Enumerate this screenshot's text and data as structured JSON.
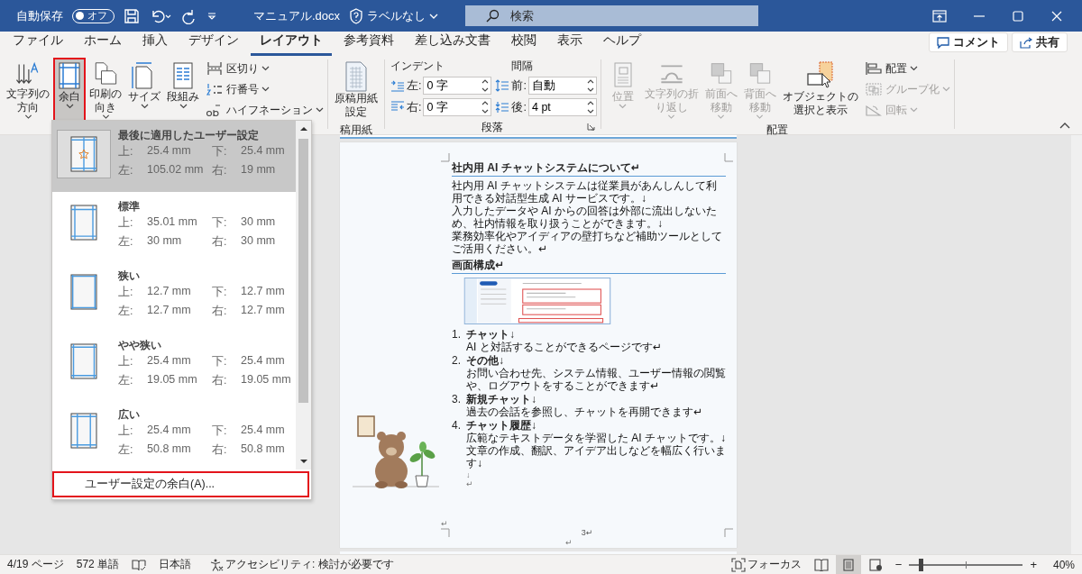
{
  "title_bar": {
    "autosave": {
      "label": "自動保存",
      "toggle_text": "オフ",
      "on": false
    },
    "document_name": "マニュアル.docx",
    "sensitivity": "ラベルなし",
    "search_placeholder": "検索"
  },
  "menu_tabs": [
    {
      "label": "ファイル",
      "selected": false
    },
    {
      "label": "ホーム",
      "selected": false
    },
    {
      "label": "挿入",
      "selected": false
    },
    {
      "label": "デザイン",
      "selected": false
    },
    {
      "label": "レイアウト",
      "selected": true
    },
    {
      "label": "参考資料",
      "selected": false
    },
    {
      "label": "差し込み文書",
      "selected": false
    },
    {
      "label": "校閲",
      "selected": false
    },
    {
      "label": "表示",
      "selected": false
    },
    {
      "label": "ヘルプ",
      "selected": false
    }
  ],
  "comment_button": "コメント",
  "share_button": "共有",
  "ribbon": {
    "page_setup": {
      "large_buttons": [
        {
          "kind": "text-direction",
          "lines": [
            "文字列の",
            "方向"
          ],
          "selected": false
        },
        {
          "kind": "margins",
          "lines": [
            "余白"
          ],
          "selected": true
        },
        {
          "kind": "orientation",
          "lines": [
            "印刷の",
            "向き"
          ],
          "selected": false
        },
        {
          "kind": "size",
          "lines": [
            "サイズ"
          ],
          "selected": false
        },
        {
          "kind": "columns",
          "lines": [
            "段組み"
          ],
          "selected": false
        }
      ],
      "small_buttons": [
        {
          "kind": "breaks",
          "label": "区切り",
          "disabled": false
        },
        {
          "kind": "line-numbers",
          "label": "行番号",
          "disabled": false
        },
        {
          "kind": "hyphenation",
          "label": "ハイフネーション",
          "disabled": false
        }
      ]
    },
    "manuscript": {
      "lines": [
        "原稿用紙",
        "設定"
      ],
      "group_label": "稿用紙"
    },
    "paragraph": {
      "indent_header": "インデント",
      "spacing_header": "間隔",
      "indent_fields": [
        {
          "kind": "left",
          "label": "左:",
          "value": "0 字"
        },
        {
          "kind": "right",
          "label": "右:",
          "value": "0 字"
        }
      ],
      "spacing_fields": [
        {
          "kind": "before",
          "label": "前:",
          "value": "自動"
        },
        {
          "kind": "after",
          "label": "後:",
          "value": "4 pt"
        }
      ],
      "group_label": "段落"
    },
    "arrange": {
      "large_buttons": [
        {
          "kind": "position",
          "lines": [
            "位置"
          ],
          "disabled": true
        },
        {
          "kind": "wrap",
          "lines": [
            "文字列の折",
            "り返し"
          ],
          "disabled": true
        },
        {
          "kind": "bring-forward",
          "lines": [
            "前面へ",
            "移動"
          ],
          "disabled": true
        },
        {
          "kind": "send-backward",
          "lines": [
            "背面へ",
            "移動"
          ],
          "disabled": true
        },
        {
          "kind": "selection-pane",
          "lines": [
            "オブジェクトの",
            "選択と表示"
          ],
          "disabled": false
        }
      ],
      "small_buttons": [
        {
          "kind": "align",
          "label": "配置",
          "disabled": false
        },
        {
          "kind": "group",
          "label": "グループ化",
          "disabled": true
        },
        {
          "kind": "rotate",
          "label": "回転",
          "disabled": true
        }
      ],
      "group_label": "配置"
    }
  },
  "margins_menu": {
    "items": [
      {
        "kind": "recent",
        "name": "最後に適用したユーザー設定",
        "selected": true,
        "fields": [
          {
            "label": "上:",
            "value": "25.4 mm"
          },
          {
            "label": "下:",
            "value": "25.4 mm"
          },
          {
            "label": "左:",
            "value": "105.02 mm"
          },
          {
            "label": "右:",
            "value": "19 mm"
          }
        ]
      },
      {
        "kind": "preset",
        "name": "標準",
        "selected": false,
        "fields": [
          {
            "label": "上:",
            "value": "35.01 mm"
          },
          {
            "label": "下:",
            "value": "30 mm"
          },
          {
            "label": "左:",
            "value": "30 mm"
          },
          {
            "label": "右:",
            "value": "30 mm"
          }
        ]
      },
      {
        "kind": "preset",
        "name": "狭い",
        "selected": false,
        "fields": [
          {
            "label": "上:",
            "value": "12.7 mm"
          },
          {
            "label": "下:",
            "value": "12.7 mm"
          },
          {
            "label": "左:",
            "value": "12.7 mm"
          },
          {
            "label": "右:",
            "value": "12.7 mm"
          }
        ]
      },
      {
        "kind": "preset",
        "name": "やや狭い",
        "selected": false,
        "fields": [
          {
            "label": "上:",
            "value": "25.4 mm"
          },
          {
            "label": "下:",
            "value": "25.4 mm"
          },
          {
            "label": "左:",
            "value": "19.05 mm"
          },
          {
            "label": "右:",
            "value": "19.05 mm"
          }
        ]
      },
      {
        "kind": "preset",
        "name": "広い",
        "selected": false,
        "fields": [
          {
            "label": "上:",
            "value": "25.4 mm"
          },
          {
            "label": "下:",
            "value": "25.4 mm"
          },
          {
            "label": "左:",
            "value": "50.8 mm"
          },
          {
            "label": "右:",
            "value": "50.8 mm"
          }
        ]
      }
    ],
    "footer": {
      "label": "ユーザー設定の余白(A)...",
      "highlighted": true
    }
  },
  "document": {
    "heading": "社内用 AI チャットシステムについて↵",
    "paragraph_lines": [
      "社内用 AI チャットシステムは従業員があんしんして利用できる対話型生成 AI サービスです。↓",
      "入力したデータや AI からの回答は外部に流出しないため、社内情報を取り扱うことができます。↓",
      "業務効率化やアイディアの壁打ちなど補助ツールとしてご活用ください。↵"
    ],
    "subheading": "画面構成↵",
    "list": [
      {
        "number": "1.",
        "title": "チャット↓",
        "lines": [
          "AI と対話することができるページです↵"
        ]
      },
      {
        "number": "2.",
        "title": "その他↓",
        "lines": [
          "お問い合わせ先、システム情報、ユーザー情報の閲覧や、ログアウトをすることができます↵"
        ]
      },
      {
        "number": "3.",
        "title": "新規チャット↓",
        "lines": [
          "過去の会話を参照し、チャットを再開できます↵"
        ]
      },
      {
        "number": "4.",
        "title": "チャット履歴↓",
        "lines": [
          "広範なテキストデータを学習した AI チャットです。↓",
          "文章の作成、翻訳、アイデア出しなどを幅広く行います↓"
        ]
      }
    ],
    "trailing_marks": [
      "↓",
      "↵"
    ],
    "section_mark": "↵",
    "page_number": "3↵",
    "after_page_mark": "↵"
  },
  "status_bar": {
    "page": "4/19 ページ",
    "words": "572 単語",
    "language": "日本語",
    "accessibility": "アクセシビリティ: 検討が必要です",
    "focus": "フォーカス",
    "views": [
      {
        "kind": "read",
        "selected": false
      },
      {
        "kind": "print",
        "selected": true
      },
      {
        "kind": "web",
        "selected": false
      }
    ],
    "zoom": {
      "minus": "−",
      "plus": "+",
      "level": 0.1,
      "reading": "40%"
    }
  }
}
